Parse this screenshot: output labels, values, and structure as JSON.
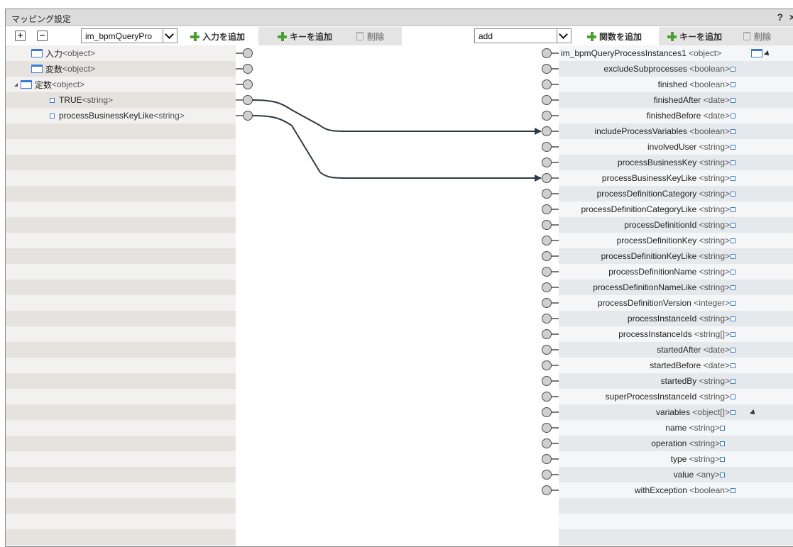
{
  "dialog": {
    "title": "マッピング設定",
    "help": "?",
    "close": "×"
  },
  "toolbar": {
    "expand_all": "+",
    "collapse_all": "−",
    "input_select_value": "im_bpmQueryPro",
    "add_input": "入力を追加",
    "add_key_left": "キーを追加",
    "delete_left": "削除",
    "function_select_value": "add",
    "add_function": "関数を追加",
    "add_key_right": "キーを追加",
    "delete_right": "削除"
  },
  "left_tree": [
    {
      "name": "入力",
      "type": "<object>"
    },
    {
      "name": "変数",
      "type": "<object>"
    },
    {
      "name": "定数",
      "type": "<object>"
    },
    {
      "name": "TRUE",
      "type": "<string>"
    },
    {
      "name": "processBusinessKeyLike",
      "type": "<string>"
    }
  ],
  "right_tree": [
    {
      "name": "im_bpmQueryProcessInstances1",
      "type": "<object>"
    },
    {
      "name": "excludeSubprocesses",
      "type": "<boolean>"
    },
    {
      "name": "finished",
      "type": "<boolean>"
    },
    {
      "name": "finishedAfter",
      "type": "<date>"
    },
    {
      "name": "finishedBefore",
      "type": "<date>"
    },
    {
      "name": "includeProcessVariables",
      "type": "<boolean>"
    },
    {
      "name": "involvedUser",
      "type": "<string>"
    },
    {
      "name": "processBusinessKey",
      "type": "<string>"
    },
    {
      "name": "processBusinessKeyLike",
      "type": "<string>"
    },
    {
      "name": "processDefinitionCategory",
      "type": "<string>"
    },
    {
      "name": "processDefinitionCategoryLike",
      "type": "<string>"
    },
    {
      "name": "processDefinitionId",
      "type": "<string>"
    },
    {
      "name": "processDefinitionKey",
      "type": "<string>"
    },
    {
      "name": "processDefinitionKeyLike",
      "type": "<string>"
    },
    {
      "name": "processDefinitionName",
      "type": "<string>"
    },
    {
      "name": "processDefinitionNameLike",
      "type": "<string>"
    },
    {
      "name": "processDefinitionVersion",
      "type": "<integer>"
    },
    {
      "name": "processInstanceId",
      "type": "<string>"
    },
    {
      "name": "processInstanceIds",
      "type": "<string[]>"
    },
    {
      "name": "startedAfter",
      "type": "<date>"
    },
    {
      "name": "startedBefore",
      "type": "<date>"
    },
    {
      "name": "startedBy",
      "type": "<string>"
    },
    {
      "name": "superProcessInstanceId",
      "type": "<string>"
    },
    {
      "name": "variables",
      "type": "<object[]>"
    },
    {
      "name": "name",
      "type": "<string>"
    },
    {
      "name": "operation",
      "type": "<string>"
    },
    {
      "name": "type",
      "type": "<string>"
    },
    {
      "name": "value",
      "type": "<any>"
    },
    {
      "name": "withException",
      "type": "<boolean>"
    }
  ],
  "mappings": [
    {
      "from": "TRUE",
      "to": "includeProcessVariables"
    },
    {
      "from": "processBusinessKeyLike",
      "to": "processBusinessKeyLike"
    }
  ],
  "colors": {
    "accent_blue": "#3a7bd5",
    "add_green": "#4aa02c",
    "wire": "#2f3a45"
  }
}
